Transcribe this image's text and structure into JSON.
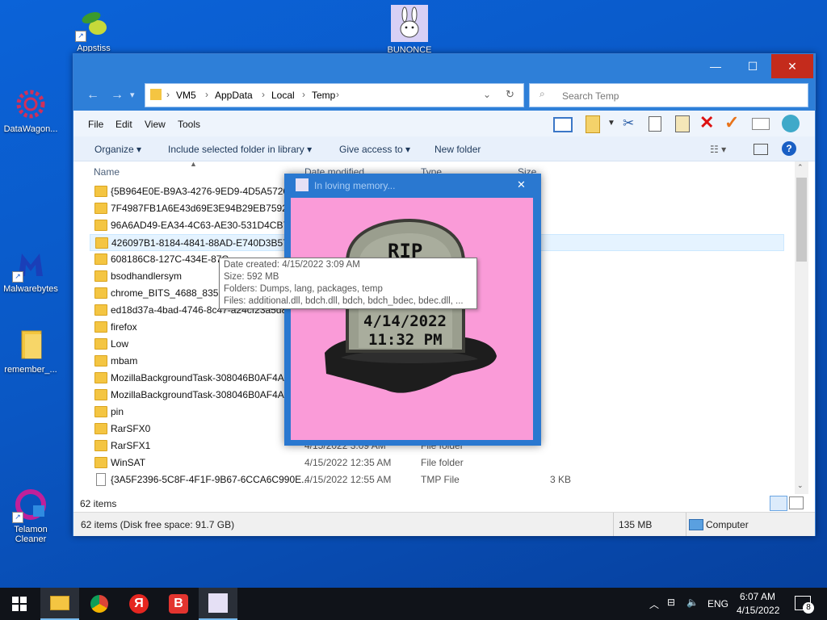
{
  "desktop_icons": [
    {
      "label": "Appstiss",
      "icon": "green-fruit-icon"
    },
    {
      "label": "BUNONCE",
      "icon": "bunny-icon"
    },
    {
      "label": "DataWagon...",
      "icon": "gear-icon"
    },
    {
      "label": "Malwarebytes",
      "icon": "malwarebytes-icon"
    },
    {
      "label": "remember_...",
      "icon": "folder-icon"
    },
    {
      "label": "Telamon\nCleaner",
      "icon": "telamon-icon"
    }
  ],
  "explorer": {
    "window_controls": {
      "minimize": "—",
      "maximize": "☐",
      "close": "✕"
    },
    "breadcrumb": [
      "VM5",
      "AppData",
      "Local",
      "Temp"
    ],
    "search_placeholder": "Search Temp",
    "menu": [
      "File",
      "Edit",
      "View",
      "Tools"
    ],
    "commands": {
      "organize": "Organize",
      "include": "Include selected folder in library",
      "share": "Give access to",
      "new_folder": "New folder"
    },
    "columns": {
      "name": "Name",
      "date": "Date modified",
      "type": "Type",
      "size": "Size"
    },
    "files": [
      {
        "name": "{5B964E0E-B9A3-4276-9ED9-4D5A572074...",
        "date": "",
        "type": "",
        "size": "",
        "kind": "folder"
      },
      {
        "name": "7F4987FB1A6E43d69E3E94B29EB75926",
        "date": "",
        "type": "",
        "size": "",
        "kind": "folder"
      },
      {
        "name": "96A6AD49-EA34-4C63-AE30-531D4CB7B...",
        "date": "",
        "type": "",
        "size": "",
        "kind": "folder"
      },
      {
        "name": "426097B1-8184-4841-88AD-E740D3B575F...",
        "date": "",
        "type": "",
        "size": "",
        "kind": "folder"
      },
      {
        "name": "608186C8-127C-434E-87C...",
        "date": "",
        "type": "",
        "size": "",
        "kind": "folder"
      },
      {
        "name": "bsodhandlersym",
        "date": "",
        "type": "",
        "size": "",
        "kind": "folder"
      },
      {
        "name": "chrome_BITS_4688_83572...",
        "date": "",
        "type": "",
        "size": "",
        "kind": "folder"
      },
      {
        "name": "ed18d37a-4bad-4746-8c47-a24cf23a5d84",
        "date": "",
        "type": "",
        "size": "",
        "kind": "folder"
      },
      {
        "name": "firefox",
        "date": "",
        "type": "",
        "size": "",
        "kind": "folder"
      },
      {
        "name": "Low",
        "date": "",
        "type": "",
        "size": "",
        "kind": "folder"
      },
      {
        "name": "mbam",
        "date": "",
        "type": "",
        "size": "",
        "kind": "folder"
      },
      {
        "name": "MozillaBackgroundTask-308046B0AF4A3...",
        "date": "",
        "type": "",
        "size": "",
        "kind": "folder"
      },
      {
        "name": "MozillaBackgroundTask-308046B0AF4A3...",
        "date": "",
        "type": "",
        "size": "",
        "kind": "folder"
      },
      {
        "name": "pin",
        "date": "",
        "type": "",
        "size": "",
        "kind": "folder"
      },
      {
        "name": "RarSFX0",
        "date": "",
        "type": "",
        "size": "",
        "kind": "folder"
      },
      {
        "name": "RarSFX1",
        "date": "4/15/2022 3:09 AM",
        "type": "File folder",
        "size": "",
        "kind": "folder"
      },
      {
        "name": "WinSAT",
        "date": "4/15/2022 12:35 AM",
        "type": "File folder",
        "size": "",
        "kind": "folder"
      },
      {
        "name": "{3A5F2396-5C8F-4F1F-9B67-6CCA6C990E...",
        "date": "4/15/2022 12:55 AM",
        "type": "TMP File",
        "size": "3 KB",
        "kind": "file"
      }
    ],
    "items_count": "62 items",
    "status_left": "62 items (Disk free space: 91.7 GB)",
    "status_size": "135 MB",
    "status_location": "Computer"
  },
  "tooltip": {
    "created": "Date created: 4/15/2022 3:09 AM",
    "size": "Size: 592 MB",
    "folders": "Folders: Dumps, lang, packages, temp",
    "files": "Files: additional.dll, bdch.dll, bdch, bdch_bdec, bdec.dll, ..."
  },
  "popup": {
    "title": "In loving memory...",
    "close": "✕",
    "tombstone": {
      "header": "RIP",
      "date": "4/14/2022",
      "time": "11:32 PM"
    }
  },
  "taskbar": {
    "apps": [
      "start-icon",
      "file-explorer-icon",
      "chrome-icon",
      "yandex-icon",
      "vivaldi-icon",
      "bunny-app-icon"
    ],
    "tray_lang": "ENG",
    "time": "6:07 AM",
    "date": "4/15/2022",
    "notifications": "8"
  }
}
